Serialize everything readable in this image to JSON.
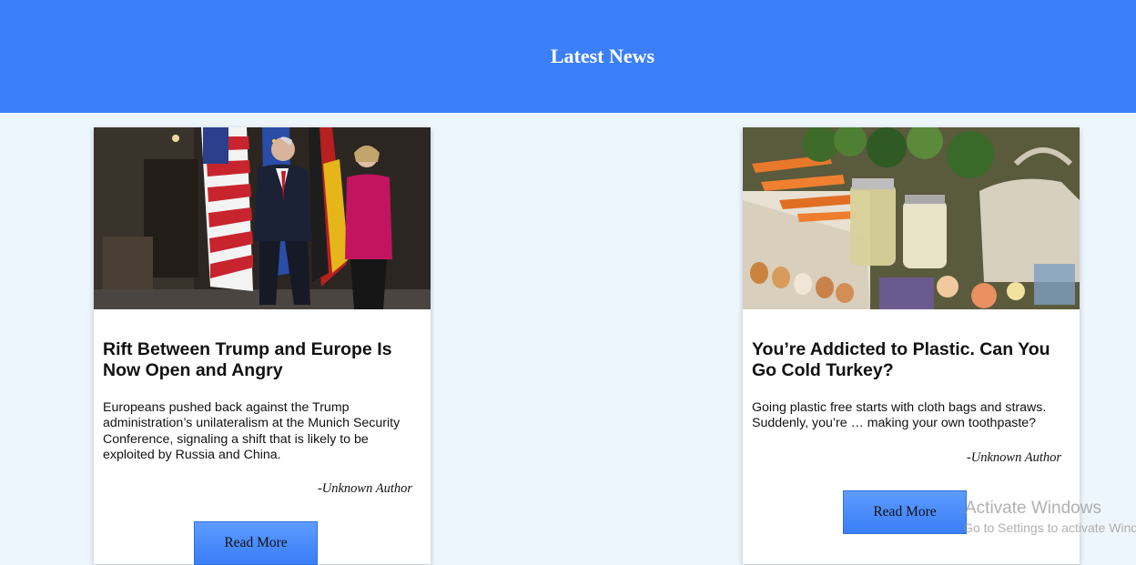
{
  "header": {
    "title": "Latest News"
  },
  "articles": [
    {
      "title": "Rift Between Trump and Europe Is Now Open and Angry",
      "summary": "Europeans pushed back against the Trump administration’s unilateralism at the Munich Security Conference, signaling a shift that is likely to be exploited by Russia and China.",
      "author": "-Unknown Author",
      "button": "Read More",
      "image_icon": "news-photo-politicians"
    },
    {
      "title": "You’re Addicted to Plastic. Can You Go Cold Turkey?",
      "summary": "Going plastic free starts with cloth bags and straws. Suddenly, you’re … making your own toothpaste?",
      "author": "-Unknown Author",
      "button": "Read More",
      "image_icon": "news-photo-groceries"
    }
  ],
  "watermark": {
    "line1": "Activate Windows",
    "line2": "Go to Settings to activate Windows."
  },
  "colors": {
    "header": "#3b7ffb",
    "background": "#eef6fd",
    "button": "#3a7ef8"
  }
}
